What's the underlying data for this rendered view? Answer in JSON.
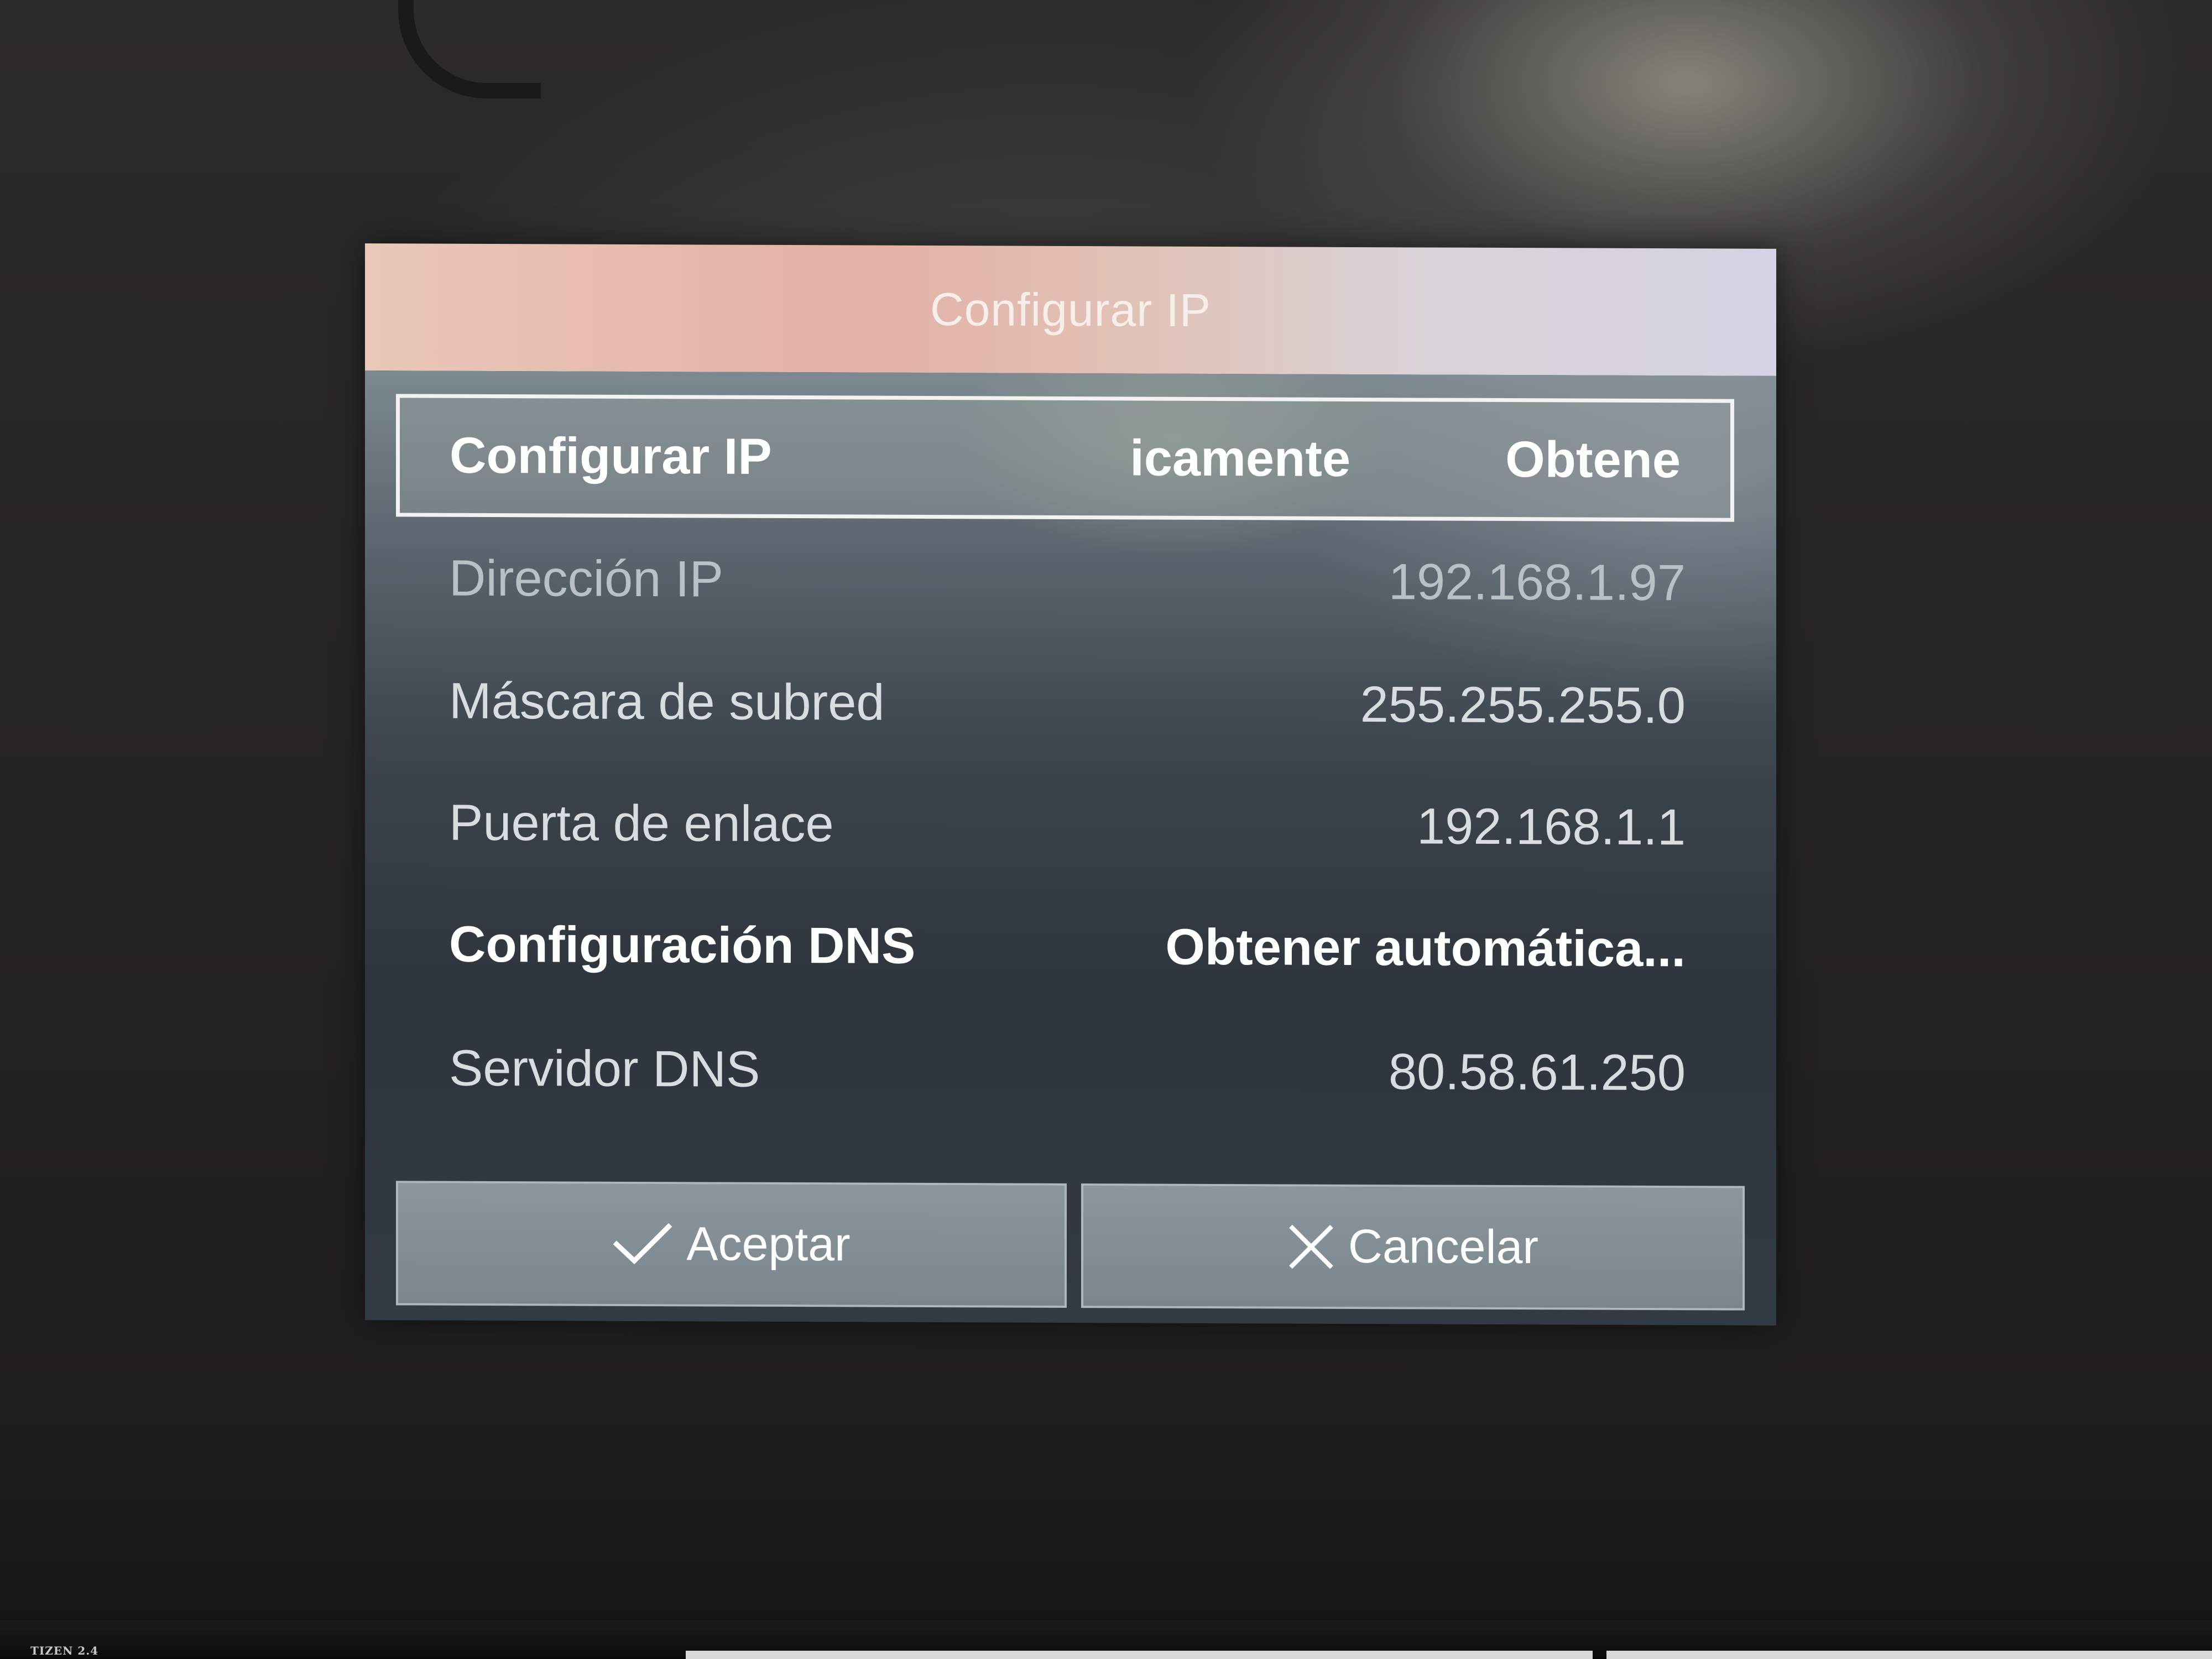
{
  "dialog": {
    "title": "Configurar IP",
    "focused_row": {
      "label": "Configurar IP",
      "value_parts": [
        "icamente",
        "Obtene"
      ]
    },
    "rows": [
      {
        "label": "Dirección IP",
        "value": "192.168.1.97",
        "state": "disabled"
      },
      {
        "label": "Máscara de subred",
        "value": "255.255.255.0",
        "state": "normal"
      },
      {
        "label": "Puerta de enlace",
        "value": "192.168.1.1",
        "state": "normal"
      },
      {
        "label": "Configuración DNS",
        "value": "Obtener automática...",
        "state": "emphasized"
      },
      {
        "label": "Servidor DNS",
        "value": "80.58.61.250",
        "state": "normal"
      }
    ],
    "buttons": {
      "accept_label": "Aceptar",
      "accept_icon": "check-icon",
      "cancel_label": "Cancelar",
      "cancel_icon": "close-icon"
    }
  },
  "bezel": {
    "logo_text": "TIZEN 2.4"
  },
  "colors": {
    "header_gradient_start": "#e9c8b7",
    "header_gradient_end": "#d5d3e4",
    "panel_top": "#7d8990",
    "panel_bottom": "#2f353d",
    "button_fill": "#8b979c",
    "focus_border": "#f2f2f2"
  }
}
